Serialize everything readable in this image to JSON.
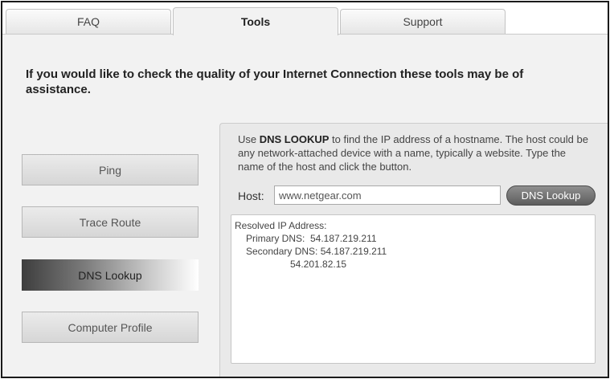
{
  "tabs": [
    {
      "label": "FAQ",
      "active": false
    },
    {
      "label": "Tools",
      "active": true
    },
    {
      "label": "Support",
      "active": false
    }
  ],
  "intro": "If you would like to check the quality of your Internet Connection these tools may be of assistance.",
  "tools": [
    {
      "label": "Ping",
      "selected": false
    },
    {
      "label": "Trace Route",
      "selected": false
    },
    {
      "label": "DNS Lookup",
      "selected": true
    },
    {
      "label": "Computer Profile",
      "selected": false
    }
  ],
  "panel": {
    "desc_prefix": "Use ",
    "desc_emphasis": "DNS LOOKUP",
    "desc_suffix": " to find the IP address of a hostname. The host could be any network-attached device with a name, typically a website. Type the name of the host and click the button.",
    "host_label": "Host:",
    "host_value": "www.netgear.com",
    "lookup_button": "DNS Lookup",
    "result": {
      "heading": "Resolved IP Address:",
      "primary": "Primary DNS:  54.187.219.211",
      "secondary": "Secondary DNS: 54.187.219.211",
      "extra": "54.201.82.15"
    }
  },
  "colors": {
    "selected_tool_gradient_start": "#3e3e3e",
    "lookup_button": "#6e6e6e",
    "frame_border": "#1a1a1a"
  }
}
